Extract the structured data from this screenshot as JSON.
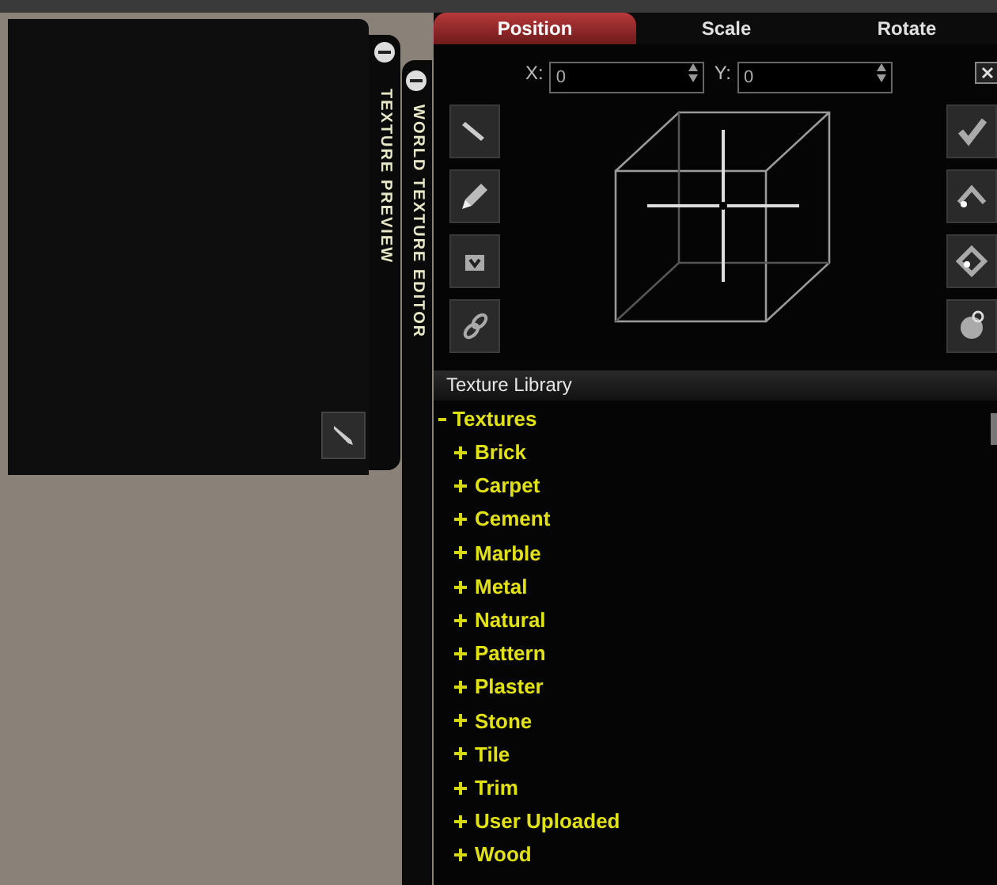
{
  "preview_panel": {
    "title": "TEXTURE PREVIEW"
  },
  "editor_panel": {
    "title": "WORLD TEXTURE EDITOR"
  },
  "tabs": [
    {
      "label": "Position",
      "selected": true
    },
    {
      "label": "Scale",
      "selected": false
    },
    {
      "label": "Rotate",
      "selected": false
    }
  ],
  "fields": [
    {
      "label": "X:",
      "value": "0"
    },
    {
      "label": "Y:",
      "value": "0"
    }
  ],
  "library": {
    "title": "Texture Library",
    "tree": [
      {
        "label": "Textures",
        "expanded": true,
        "children": [
          {
            "label": "Brick",
            "expanded": false
          },
          {
            "label": "Carpet",
            "expanded": false
          },
          {
            "label": "Cement",
            "expanded": false
          },
          {
            "label": "Marble",
            "expanded": false
          },
          {
            "label": "Metal",
            "expanded": false
          },
          {
            "label": "Natural",
            "expanded": false
          },
          {
            "label": "Pattern",
            "expanded": false
          },
          {
            "label": "Plaster",
            "expanded": false
          },
          {
            "label": "Stone",
            "expanded": false
          },
          {
            "label": "Tile",
            "expanded": false
          },
          {
            "label": "Trim",
            "expanded": false
          },
          {
            "label": "User Uploaded",
            "expanded": false
          },
          {
            "label": "Wood",
            "expanded": false
          }
        ]
      }
    ]
  }
}
